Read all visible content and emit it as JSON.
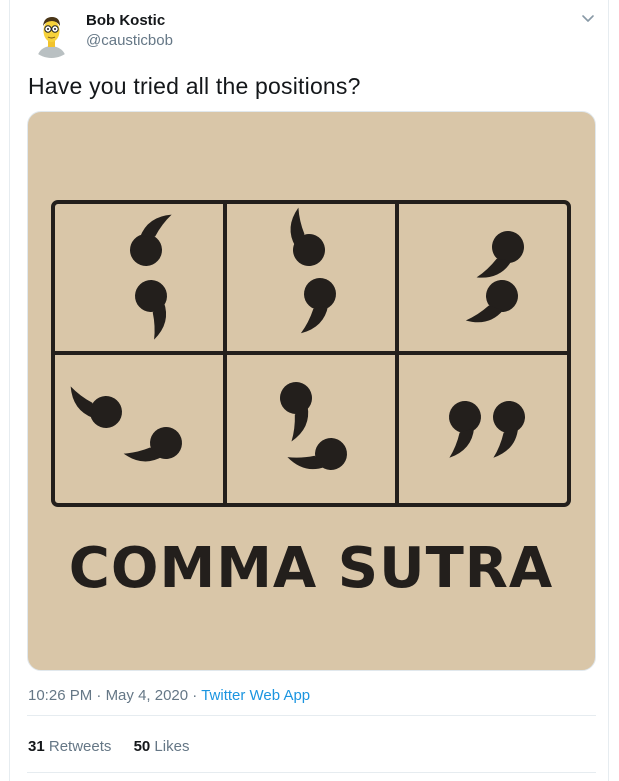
{
  "author": {
    "name": "Bob Kostic",
    "handle": "@causticbob"
  },
  "tweet": {
    "text": "Have you tried all the positions?"
  },
  "media": {
    "image_caption": "COMMA SUTRA",
    "background_color": "#d9c6a8"
  },
  "meta": {
    "time": "10:26 PM",
    "separator": "·",
    "date": "May 4, 2020",
    "app": "Twitter Web App"
  },
  "stats": {
    "retweets_count": "31",
    "retweets_label": "Retweets",
    "likes_count": "50",
    "likes_label": "Likes"
  },
  "colors": {
    "link": "#1b95e0",
    "secondary_text": "#657786",
    "primary_text": "#14171a"
  },
  "icons": {
    "menu": "chevron-down-icon",
    "avatar": "cartoon-avatar"
  }
}
